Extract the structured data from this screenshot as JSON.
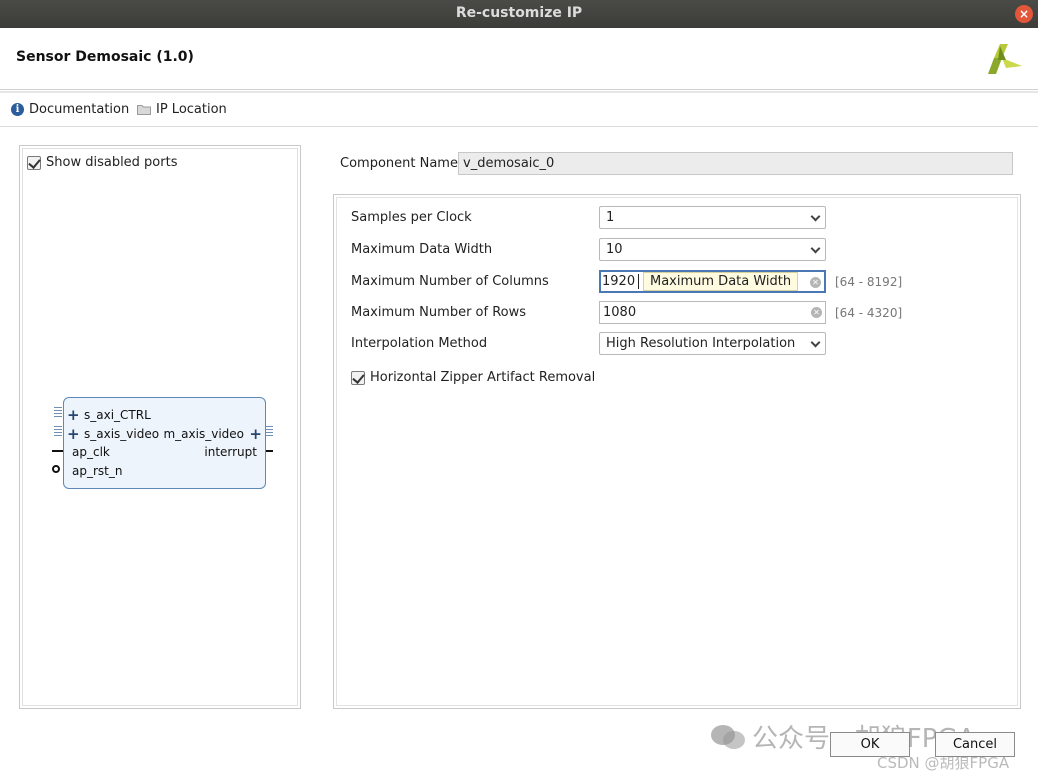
{
  "window": {
    "title": "Re-customize IP",
    "close_glyph": "×"
  },
  "header": {
    "ip_title": "Sensor Demosaic (1.0)",
    "logo_icon": "xilinx-logo-icon"
  },
  "toolbar": {
    "documentation_label": "Documentation",
    "ip_location_label": "IP Location"
  },
  "symbol_panel": {
    "show_disabled_ports_label": "Show disabled ports",
    "show_disabled_ports_checked": true,
    "block": {
      "left_ports": [
        "s_axi_CTRL",
        "s_axis_video",
        "ap_clk",
        "ap_rst_n"
      ],
      "right_ports": [
        "m_axis_video",
        "interrupt"
      ]
    }
  },
  "component": {
    "label": "Component Name",
    "value": "v_demosaic_0"
  },
  "params": {
    "samples_per_clock": {
      "label": "Samples per Clock",
      "value": "1"
    },
    "max_data_width": {
      "label": "Maximum Data Width",
      "value": "10"
    },
    "max_columns": {
      "label": "Maximum Number of Columns",
      "value": "1920",
      "range": "[64 - 8192]",
      "tooltip": "Maximum Data Width"
    },
    "max_rows": {
      "label": "Maximum Number of Rows",
      "value": "1080",
      "range": "[64 - 4320]"
    },
    "interpolation": {
      "label": "Interpolation Method",
      "value": "High Resolution Interpolation"
    },
    "zipper": {
      "label": "Horizontal Zipper Artifact Removal",
      "checked": true
    }
  },
  "buttons": {
    "ok": "OK",
    "cancel": "Cancel"
  },
  "watermark": {
    "main": "公众号 · 胡狼FPGA",
    "sub": "CSDN @胡狼FPGA"
  },
  "colors": {
    "titlebar": "#3c3c39",
    "accent": "#4a78b5",
    "block_fill": "#eef4fb",
    "close": "#e2563a"
  }
}
